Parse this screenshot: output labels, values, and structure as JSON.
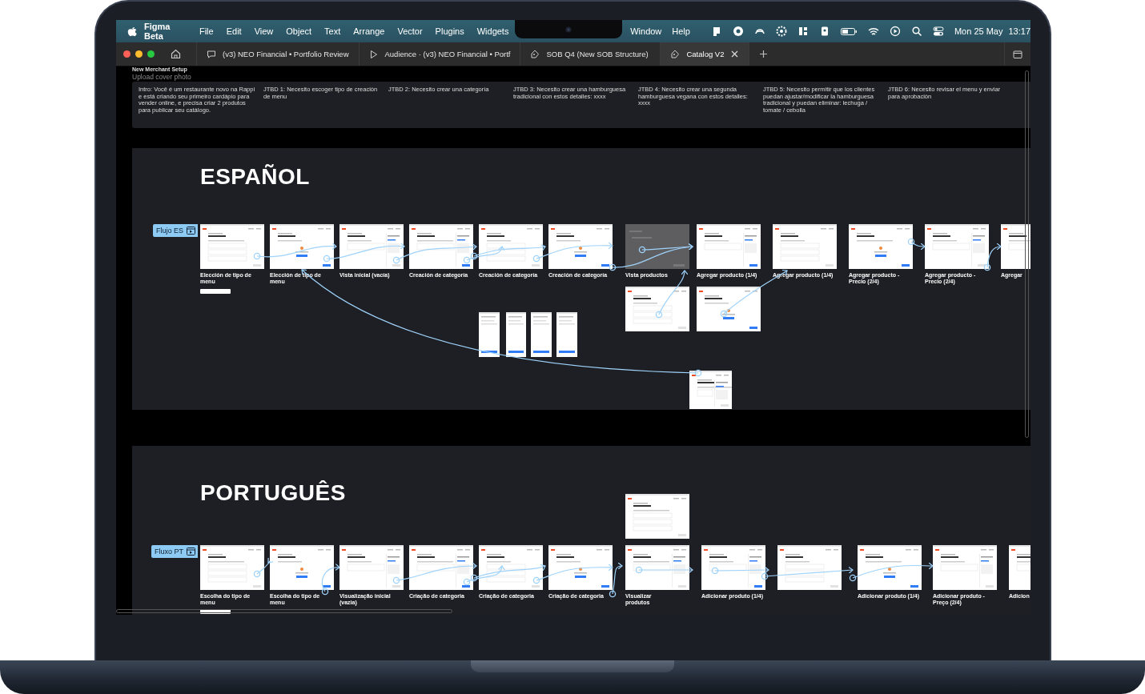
{
  "menu_bar": {
    "app": "Figma Beta",
    "menus": [
      "File",
      "Edit",
      "View",
      "Object",
      "Text",
      "Arrange",
      "Vector",
      "Plugins",
      "Widgets"
    ],
    "right_menus": [
      "Window",
      "Help"
    ],
    "date": "Mon 25 May",
    "time": "13:17"
  },
  "tabs": [
    {
      "label": "(v3) NEO Financial • Portfolio Review",
      "kind": "comment",
      "selected": false
    },
    {
      "label": "Audience · (v3) NEO Financial • Portf",
      "kind": "play",
      "selected": false
    },
    {
      "label": "SOB Q4 (New SOB Structure)",
      "kind": "file",
      "selected": false
    },
    {
      "label": "Catalog V2",
      "kind": "file",
      "selected": true
    }
  ],
  "canvas": {
    "page_title": "New Merchant Setup",
    "subtitle": "Upload cover photo",
    "notes": [
      "Intro: Você é um restaurante novo na Rappi e está criando seu primeiro cardápio para vender online, e precisa criar 2 produtos para publicar seu catálogo.",
      "JTBD 1: Necesito escoger tipo de creación de menu",
      "JTBD 2: Necesito crear una categoría",
      "JTBD 3: Necesito crear una hamburguesa tradicional con estos detalles: xxxx",
      "JTBD 4: Necesito crear una segunda hamburguesa vegana con estos detalles: xxxx",
      "JTBD 5: Necesito permitir que los clientes puedan ajustar/modificar la hamburguesa tradicional y puedan eliminar: lechuga / tomate / cebolla",
      "JTBD 6: Necesito revisar el menu y enviar para aprobación"
    ],
    "sections": [
      {
        "title": "ESPAÑOL",
        "flow_label": "Flujo ES",
        "frames": [
          {
            "caption": "Elección de tipo de menu",
            "kind": "screen"
          },
          {
            "caption": "Elección de tipo de menu",
            "kind": "screen"
          },
          {
            "caption": "Vista inicial (vacía)",
            "kind": "screen"
          },
          {
            "caption": "Creación de categoría",
            "kind": "screen"
          },
          {
            "caption": "Creación de categoría",
            "kind": "screen"
          },
          {
            "caption": "Creación de categoría",
            "kind": "screen"
          },
          {
            "caption": "Vista productos",
            "kind": "dimmed"
          },
          {
            "caption": "Agregar producto (1/4)",
            "kind": "screen"
          },
          {
            "caption": "Agregar producto (1/4)",
            "kind": "screen"
          },
          {
            "caption": "Agregar producto - Precio (2/4)",
            "kind": "screen"
          },
          {
            "caption": "Agregar producto - Precio (2/4)",
            "kind": "screen"
          },
          {
            "caption": "Agregar",
            "kind": "screen"
          },
          {
            "kind": "narrow"
          },
          {
            "kind": "narrow"
          },
          {
            "kind": "narrow"
          },
          {
            "kind": "narrow"
          },
          {
            "kind": "screen"
          },
          {
            "kind": "screen"
          },
          {
            "kind": "screen"
          }
        ]
      },
      {
        "title": "PORTUGUÊS",
        "flow_label": "Fluxo PT",
        "frames": [
          {
            "caption": "Escolha do tipo de menu",
            "kind": "screen"
          },
          {
            "caption": "Escolha do tipo de menu",
            "kind": "screen"
          },
          {
            "caption": "Visualização inicial (vazia)",
            "kind": "screen"
          },
          {
            "caption": "Criação de categoria",
            "kind": "screen"
          },
          {
            "caption": "Criação de categoria",
            "kind": "screen"
          },
          {
            "caption": "Criação de categoria",
            "kind": "screen"
          },
          {
            "caption": "Visualizar produtos",
            "kind": "screen"
          },
          {
            "caption": "Adicionar produto (1/4)",
            "kind": "screen"
          },
          {
            "kind": "screen"
          },
          {
            "caption": "Adicionar produto (1/4)",
            "kind": "screen"
          },
          {
            "caption": "Adicionar produto - Preço (2/4)",
            "kind": "screen"
          },
          {
            "caption": "Adicion",
            "kind": "screen"
          },
          {
            "kind": "screen"
          }
        ]
      }
    ]
  }
}
